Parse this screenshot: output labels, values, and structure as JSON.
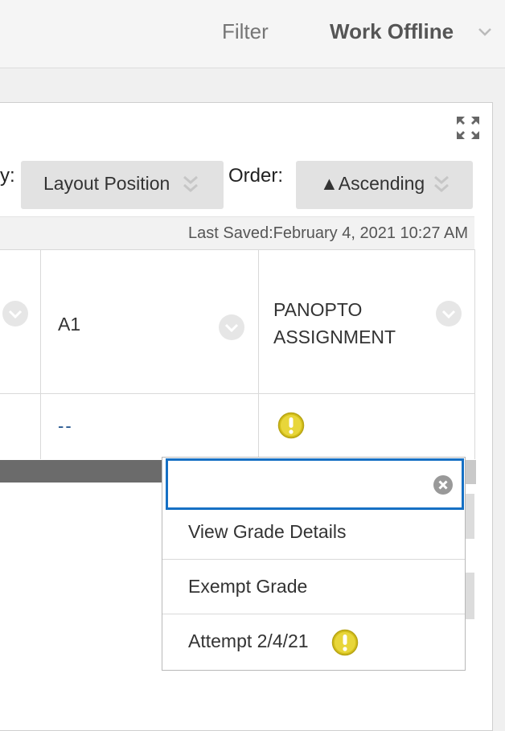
{
  "topbar": {
    "filter_label": "Filter",
    "work_offline_label": "Work Offline",
    "work_offline_icon": "chevron-down-icon"
  },
  "toolbar": {
    "sort_by_label": "y:",
    "sort_by_value": "Layout Position",
    "order_label": "Order:",
    "order_value": "▲Ascending",
    "expand_icon": "expand-icon"
  },
  "status": {
    "last_saved": "Last Saved:February 4, 2021 10:27 AM"
  },
  "grid": {
    "columns": [
      {
        "label": ""
      },
      {
        "label": "A1"
      },
      {
        "label_line1": "PANOPTO",
        "label_line2": "ASSIGNMENT"
      }
    ],
    "rows": [
      {
        "cells": [
          "",
          "--",
          "needs-grading-icon"
        ]
      }
    ]
  },
  "menu": {
    "search_value": "",
    "items": [
      {
        "label": "View Grade Details"
      },
      {
        "label": "Exempt Grade"
      },
      {
        "label": "Attempt 2/4/21",
        "icon": "needs-grading-icon"
      }
    ]
  },
  "colors": {
    "accent": "#1670c4",
    "warning": "#d4c01c"
  }
}
